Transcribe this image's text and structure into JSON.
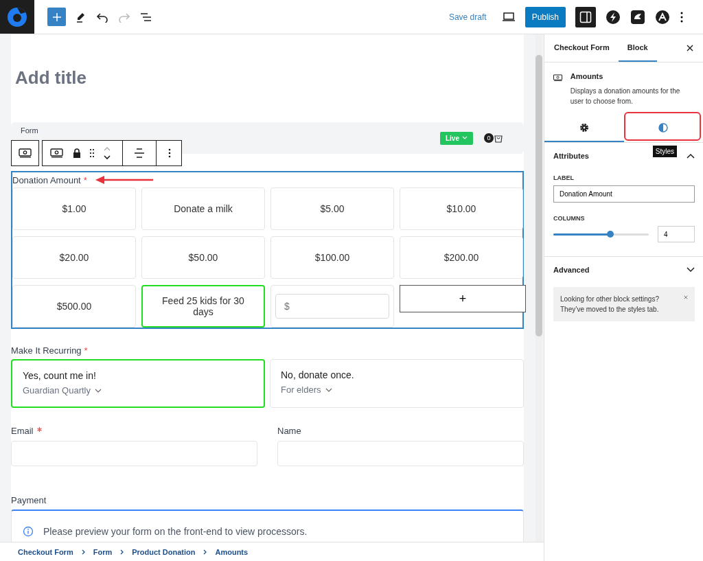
{
  "toolbar": {
    "save_draft": "Save draft",
    "publish": "Publish"
  },
  "editor": {
    "title_placeholder": "Add title",
    "form_label": "Form",
    "live_badge": "Live",
    "cart_count": "0",
    "amounts": {
      "label": "Donation Amount",
      "required_mark": "*",
      "items": [
        {
          "kind": "amount",
          "text": "$1.00",
          "selected": false
        },
        {
          "kind": "amount",
          "text": "Donate a milk",
          "selected": false
        },
        {
          "kind": "amount",
          "text": "$5.00",
          "selected": false
        },
        {
          "kind": "amount",
          "text": "$10.00",
          "selected": false
        },
        {
          "kind": "amount",
          "text": "$20.00",
          "selected": false
        },
        {
          "kind": "amount",
          "text": "$50.00",
          "selected": false
        },
        {
          "kind": "amount",
          "text": "$100.00",
          "selected": false
        },
        {
          "kind": "amount",
          "text": "$200.00",
          "selected": false
        },
        {
          "kind": "amount",
          "text": "$500.00",
          "selected": false
        },
        {
          "kind": "amount",
          "text": "Feed 25 kids for 30 days",
          "selected": true
        },
        {
          "kind": "custom",
          "placeholder": "$"
        },
        {
          "kind": "add",
          "text": "+"
        }
      ]
    },
    "recurring": {
      "label": "Make It Recurring",
      "required_mark": "*",
      "options": [
        {
          "title": "Yes, count me in!",
          "plan": "Guardian Quartly",
          "selected": true
        },
        {
          "title": "No, donate once.",
          "plan": "For elders",
          "selected": false
        }
      ]
    },
    "fields": [
      {
        "label": "Email",
        "required": true
      },
      {
        "label": "Name",
        "required": false
      }
    ],
    "payment": {
      "label": "Payment",
      "notice": "Please preview your form on the front-end to view processors."
    }
  },
  "breadcrumb": [
    "Checkout Form",
    "Form",
    "Product Donation",
    "Amounts"
  ],
  "sidebar": {
    "tabs": [
      {
        "label": "Checkout Form",
        "selected": false
      },
      {
        "label": "Block",
        "selected": true
      }
    ],
    "block": {
      "name": "Amounts",
      "description": "Displays a donation amounts for the user to choose from."
    },
    "subtabs": [
      {
        "kind": "settings",
        "selected": true
      },
      {
        "kind": "styles",
        "selected": false
      }
    ],
    "tooltip": "Styles",
    "attributes": {
      "title": "Attributes",
      "expanded": true,
      "label_caption": "LABEL",
      "label_value": "Donation Amount",
      "columns_caption": "COLUMNS",
      "columns_slider": {
        "level": 0.6
      },
      "columns_value": "4"
    },
    "advanced": {
      "title": "Advanced",
      "expanded": false
    },
    "notice": "Looking for other block settings? They’ve moved to the styles tab."
  }
}
